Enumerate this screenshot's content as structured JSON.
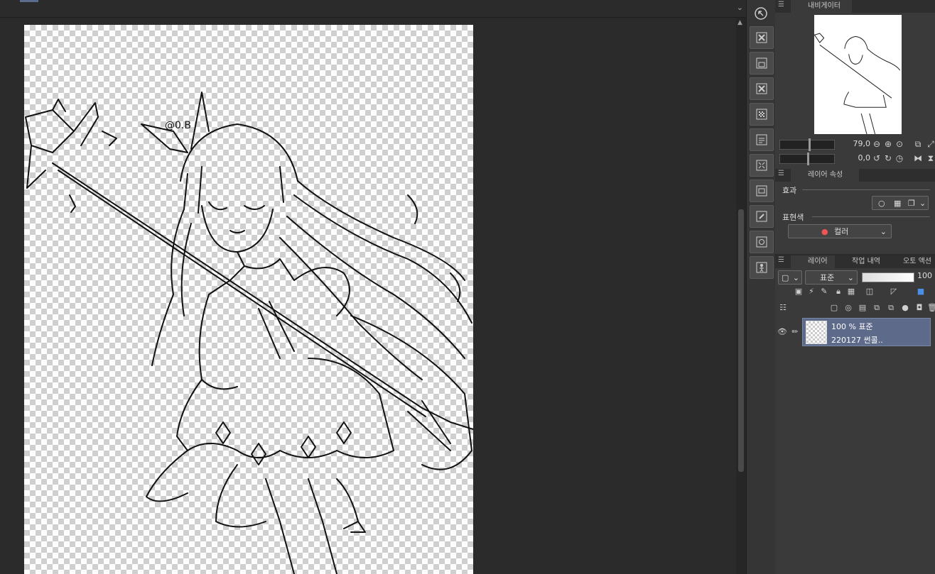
{
  "canvas": {
    "label": "artwork-canvas"
  },
  "navigator": {
    "tab_label": "내비게이터",
    "zoom_value": "79,0",
    "rotate_value": "0,0"
  },
  "layer_property": {
    "tab_label": "레이어 속성",
    "effect_label": "효과",
    "expression_color_label": "표현색",
    "expression_color_value": "컬러"
  },
  "layer_panel": {
    "tabs": [
      "레이어",
      "작업 내역",
      "오토 액션"
    ],
    "blend_mode": "표준",
    "opacity": "100",
    "layers": [
      {
        "line1": "100 % 표준",
        "line2": "220127 썬콜.."
      }
    ]
  },
  "toolbar": {
    "buttons": [
      "cursor-icon",
      "delete-icon",
      "save-icon",
      "clear-icon",
      "transparent-icon",
      "doc-icon",
      "fit-icon",
      "frame-icon",
      "edit-icon",
      "mask-icon",
      "person-icon"
    ]
  },
  "colors": {
    "panel_bg": "#3a3a3a",
    "selection": "#5d6a8a",
    "canvas_bg": "#2b2b2b"
  }
}
